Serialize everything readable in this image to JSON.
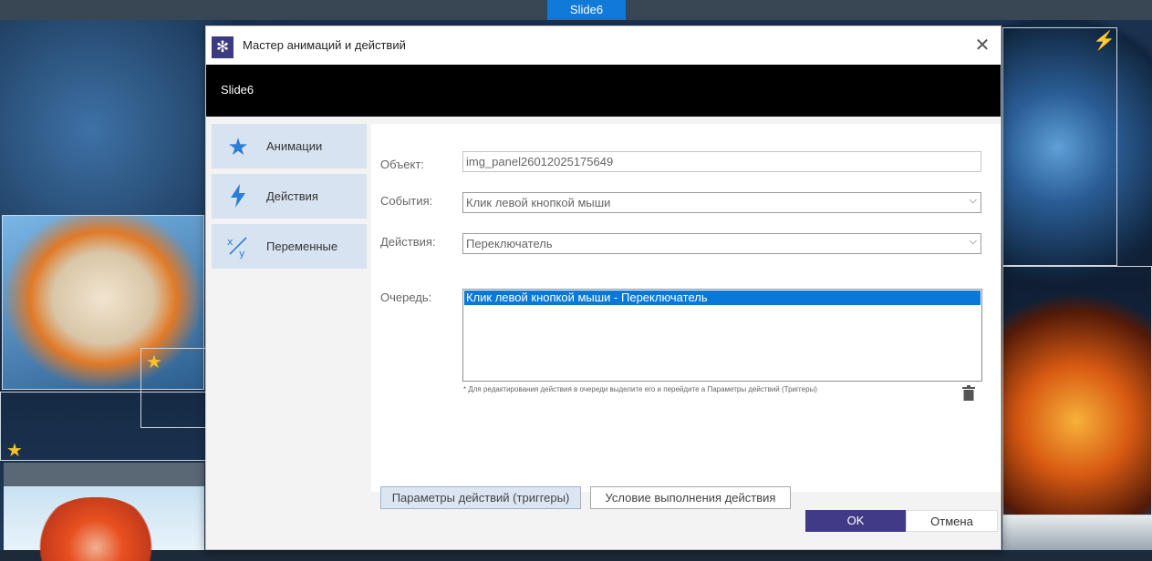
{
  "editor": {
    "slide_tab": "Slide6"
  },
  "dialog": {
    "title": "Мастер анимаций и действий",
    "close_icon": "close-icon",
    "header_title": "Slide6",
    "nav": [
      {
        "label": "Анимации",
        "icon": "star-icon"
      },
      {
        "label": "Действия",
        "icon": "lightning-icon"
      },
      {
        "label": "Переменные",
        "icon": "variables-icon"
      }
    ],
    "form": {
      "object_label": "Объект:",
      "object_value": "img_panel26012025175649",
      "events_label": "События:",
      "events_value": "Клик левой кнопкой мыши",
      "actions_label": "Действия:",
      "actions_value": "Переключатель",
      "queue_label": "Очередь:",
      "queue_items": [
        "Клик левой кнопкой мыши - Переключатель"
      ],
      "hint": "* Для редактирования действия в очереди выделите его и перейдите а Параметры действий (Триггеры)"
    },
    "buttons": {
      "params": "Параметры действий (триггеры)",
      "condition": "Условие выполнения действия",
      "ok": "OK",
      "cancel": "Отмена"
    }
  },
  "colors": {
    "accent": "#413a86",
    "selection": "#0a78d7",
    "nav_bg": "#d7e3f0",
    "slide_tab": "#1179d8"
  }
}
